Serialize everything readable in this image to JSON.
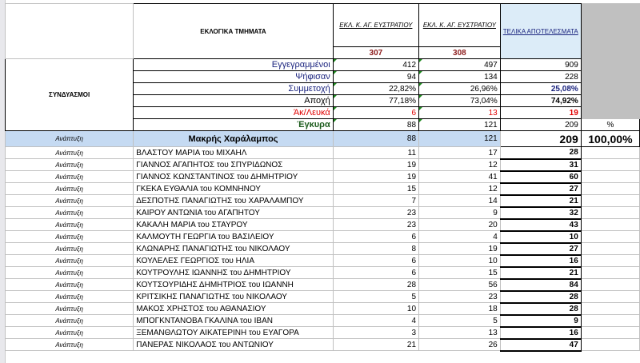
{
  "header": {
    "col_b": "ΕΚΛΟΓΙΚΑ ΤΜΗΜΑΤΑ",
    "col_a": "ΣΥΝΔΥΑΣΜΟΙ",
    "col_c": "ΕΚΛ. Κ. ΑΓ. ΕΥΣΤΡΑΤΙΟΥ",
    "col_d": "ΕΚΛ. Κ. ΑΓ. ΕΥΣΤΡΑΤΙΟΥ",
    "col_e": "ΤΕΛΙΚΑ ΑΠΟΤΕΛΕΣΜΑΤΑ",
    "code_c": "307",
    "code_d": "308"
  },
  "stats": [
    {
      "label": "Εγγεγραμμένοι",
      "c": "412",
      "d": "497",
      "e": "909",
      "color": "#1a237e"
    },
    {
      "label": "Ψήφισαν",
      "c": "94",
      "d": "134",
      "e": "228",
      "color": "#1a237e"
    },
    {
      "label": "Συμμετοχή",
      "c": "22,82%",
      "d": "26,96%",
      "e": "25,08%",
      "color": "#1a237e"
    },
    {
      "label": "Αποχή",
      "c": "77,18%",
      "d": "73,04%",
      "e": "74,92%",
      "color": "#000000"
    },
    {
      "label": "Άκ/Λευκά",
      "c": "6",
      "d": "13",
      "e": "19",
      "color": "#e00000"
    },
    {
      "label": "Έγκυρα",
      "c": "88",
      "d": "121",
      "e": "209",
      "color": "#1a5a1a",
      "f": "%"
    }
  ],
  "leader": {
    "party": "Ανάπτυξη",
    "name": "Μακρής Χαράλαμπος",
    "c": "88",
    "d": "121",
    "e": "209",
    "f": "100,00%"
  },
  "candidates": [
    {
      "party": "Ανάπτυξη",
      "name": "ΒΛΑΣΤΟΥ ΜΑΡΙΑ του ΜΙΧΑΗΛ",
      "c": "11",
      "d": "17",
      "e": "28"
    },
    {
      "party": "Ανάπτυξη",
      "name": "ΓΙΑΝΝΟΣ ΑΓΑΠΗΤΟΣ του ΣΠΥΡΙΔΩΝΟΣ",
      "c": "19",
      "d": "12",
      "e": "31"
    },
    {
      "party": "Ανάπτυξη",
      "name": "ΓΙΑΝΝΟΣ ΚΩΝΣΤΑΝΤΙΝΟΣ του ΔΗΜΗΤΡΙΟΥ",
      "c": "19",
      "d": "41",
      "e": "60"
    },
    {
      "party": "Ανάπτυξη",
      "name": "ΓΚΕΚΑ ΕΥΘΑΛΙΑ του ΚΟΜΝΗΝΟΥ",
      "c": "15",
      "d": "12",
      "e": "27"
    },
    {
      "party": "Ανάπτυξη",
      "name": "ΔΕΣΠΟΤΗΣ ΠΑΝΑΓΙΩΤΗΣ του ΧΑΡΑΛΑΜΠΟΥ",
      "c": "7",
      "d": "14",
      "e": "21"
    },
    {
      "party": "Ανάπτυξη",
      "name": "ΚΑΙΡΟΥ ΑΝΤΩΝΙΑ του ΑΓΑΠΗΤΟΥ",
      "c": "23",
      "d": "9",
      "e": "32"
    },
    {
      "party": "Ανάπτυξη",
      "name": "ΚΑΚΑΛΗ ΜΑΡΙΑ του ΣΤΑΥΡΟΥ",
      "c": "23",
      "d": "20",
      "e": "43"
    },
    {
      "party": "Ανάπτυξη",
      "name": "ΚΑΛΜΟΥΤΗ ΓΕΩΡΓΙΑ  του ΒΑΣΙΛΕΙΟΥ",
      "c": "6",
      "d": "4",
      "e": "10"
    },
    {
      "party": "Ανάπτυξη",
      "name": "ΚΛΩΝΑΡΗΣ ΠΑΝΑΓΙΩΤΗΣ του ΝΙΚΟΛΑΟΥ",
      "c": "8",
      "d": "19",
      "e": "27"
    },
    {
      "party": "Ανάπτυξη",
      "name": "ΚΟΥΛΕΛΕΣ ΓΕΩΡΓΙΟΣ του ΗΛΙΑ",
      "c": "6",
      "d": "10",
      "e": "16"
    },
    {
      "party": "Ανάπτυξη",
      "name": "ΚΟΥΤΡΟΥΛΗΣ ΙΩΑΝΝΗΣ  του ΔΗΜΗΤΡΙΟΥ",
      "c": "6",
      "d": "15",
      "e": "21"
    },
    {
      "party": "Ανάπτυξη",
      "name": "ΚΟΥΤΣΟΥΡΙΔΗΣ ΔΗΜΗΤΡΙΟΣ  του ΙΩΑΝΝΗ",
      "c": "28",
      "d": "56",
      "e": "84"
    },
    {
      "party": "Ανάπτυξη",
      "name": "ΚΡΙΤΣΙΚΗΣ ΠΑΝΑΓΙΩΤΗΣ  του ΝΙΚΟΛΑΟΥ",
      "c": "5",
      "d": "23",
      "e": "28"
    },
    {
      "party": "Ανάπτυξη",
      "name": "ΜΑΚΟΣ ΧΡΗΣΤΟΣ  του ΑΘΑΝΑΣΙΟΥ",
      "c": "10",
      "d": "18",
      "e": "28"
    },
    {
      "party": "Ανάπτυξη",
      "name": "ΜΠΟΓΚΝΤΑΝΟΒΑ ΓΚΑΛΙΝΑ  του ΙΒΑΝ",
      "c": "4",
      "d": "5",
      "e": "9"
    },
    {
      "party": "Ανάπτυξη",
      "name": "ΞΕΜΑΝΘΛΩΤΟΥ ΑΙΚΑΤΕΡΙΝΗ  του ΕΥΑΓΟΡΑ",
      "c": "3",
      "d": "13",
      "e": "16"
    },
    {
      "party": "Ανάπτυξη",
      "name": "ΠΑΝΕΡΑΣ ΝΙΚΟΛΑΟΣ  του ΑΝΤΩΝΙΟΥ",
      "c": "21",
      "d": "26",
      "e": "47"
    }
  ]
}
